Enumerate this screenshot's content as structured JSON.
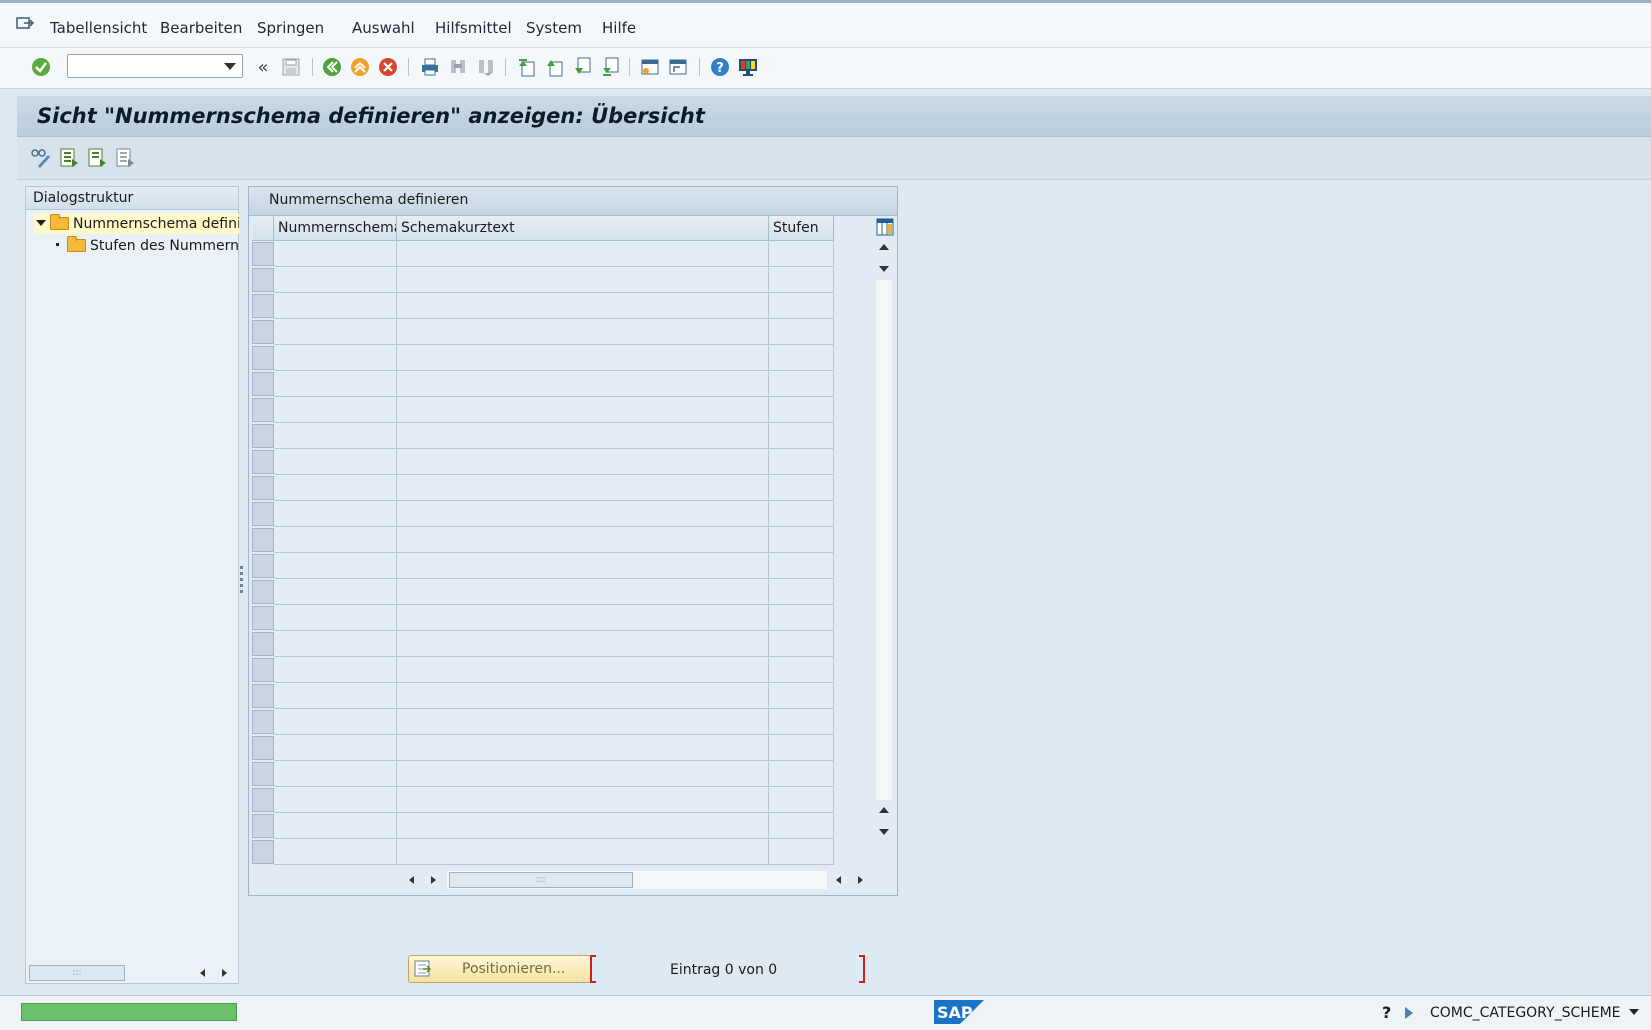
{
  "menubar": {
    "items": [
      "Tabellensicht",
      "Bearbeiten",
      "Springen",
      "Auswahl",
      "Hilfsmittel",
      "System",
      "Hilfe"
    ]
  },
  "toolbar": {
    "command_field_value": "",
    "icons": [
      "enter-icon",
      "back-double-arrow-icon",
      "save-icon",
      "back-icon",
      "exit-icon",
      "cancel-icon",
      "print-icon",
      "find-icon",
      "find-next-icon",
      "first-page-icon",
      "previous-page-icon",
      "next-page-icon",
      "last-page-icon",
      "create-session-icon",
      "shortcut-icon",
      "help-icon",
      "customize-layout-icon"
    ]
  },
  "title": "Sicht \"Nummernschema definieren\" anzeigen: Übersicht",
  "dialog_structure": {
    "header": "Dialogstruktur",
    "nodes": [
      "Nummernschema definieren",
      "Stufen des Nummernschemas"
    ]
  },
  "table": {
    "title": "Nummernschema definieren",
    "columns": [
      "Nummernschema",
      "Schemakurztext",
      "Stufen"
    ],
    "row_count": 24,
    "rows": []
  },
  "footer": {
    "position_button": "Positionieren...",
    "entry_text": "Eintrag 0 von 0"
  },
  "status": {
    "system_info": "COMC_CATEGORY_SCHEME",
    "logo": "SAP"
  }
}
